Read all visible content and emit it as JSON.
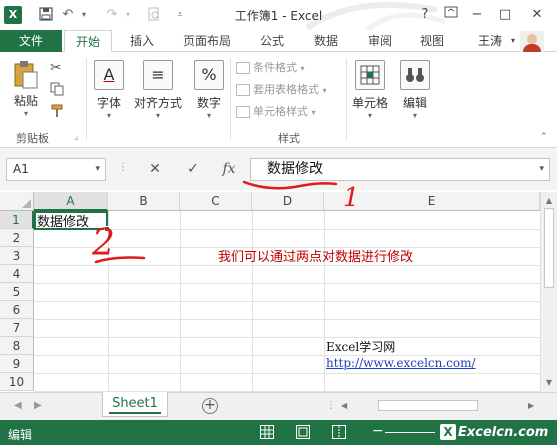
{
  "window": {
    "title": "工作簿1 - Excel",
    "help": "?",
    "minimize": "−",
    "restore": "□",
    "close": "✕"
  },
  "ribbon_tabs": {
    "file": "文件",
    "items": [
      "开始",
      "插入",
      "页面布局",
      "公式",
      "数据",
      "审阅",
      "视图"
    ],
    "active_index": 0,
    "user_name": "王涛"
  },
  "ribbon": {
    "clipboard": {
      "paste": "粘贴",
      "group_label": "剪贴板"
    },
    "font": {
      "label": "字体",
      "icon": "A"
    },
    "alignment": {
      "label": "对齐方式",
      "icon": "≡"
    },
    "number": {
      "label": "数字",
      "icon": "%"
    },
    "styles": {
      "conditional": "条件格式",
      "table": "套用表格格式",
      "cell_styles": "单元格样式",
      "group_label": "样式"
    },
    "cells": {
      "label": "单元格"
    },
    "editing": {
      "label": "编辑"
    }
  },
  "formula_bar": {
    "name_box": "A1",
    "cancel": "✕",
    "enter": "✓",
    "fx": "fx",
    "content": "数据修改"
  },
  "grid": {
    "columns": [
      "A",
      "B",
      "C",
      "D",
      "E"
    ],
    "rows": [
      "1",
      "2",
      "3",
      "4",
      "5",
      "6",
      "7",
      "8",
      "9",
      "10"
    ],
    "selected_column": "A",
    "selected_row": "1",
    "cells": {
      "A1": "数据修改",
      "D3": "我们可以通过两点对数据进行修改",
      "D8": "Excel学习网",
      "D9": "http://www.excelcn.com/"
    }
  },
  "annotations": {
    "mark_1": "1",
    "mark_2": "2"
  },
  "sheets": {
    "tabs": [
      "Sheet1"
    ],
    "active": "Sheet1",
    "add": "+"
  },
  "status": {
    "mode": "编辑",
    "zoom_minus": "−"
  },
  "watermark": {
    "text": "Excelcn.com",
    "badge": "X"
  },
  "colors": {
    "accent": "#217346",
    "annotation_red": "#e01b1b",
    "link_blue": "#1f3fbf",
    "note_red": "#c00000"
  }
}
